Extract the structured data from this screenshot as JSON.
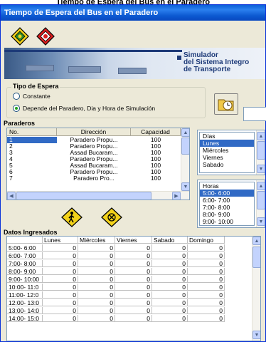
{
  "page_heading": "Tiempo de Espera del Bus en el Paradero",
  "window": {
    "title": "Tiempo de Espera del Bus en el Paradero"
  },
  "toolbar": {
    "buttons": [
      {
        "name": "yellow-diamond-icon"
      },
      {
        "name": "red-diamond-icon"
      }
    ]
  },
  "banner": {
    "line1": "Simulador",
    "line2": "del Sistema Integro",
    "line3": "de Transporte"
  },
  "tipo_espera": {
    "legend": "Tipo de Espera",
    "options": [
      {
        "label": "Constante",
        "selected": false
      },
      {
        "label": "Depende del Paradero, Dia y Hora de Simulación",
        "selected": true
      }
    ]
  },
  "clock_input_value": "",
  "paraderos": {
    "label": "Paraderos",
    "columns": [
      "No.",
      "Dirección",
      "Capacidad"
    ],
    "rows": [
      {
        "no": "1",
        "direccion": "Paradero Propu...",
        "capacidad": "100",
        "selected": true
      },
      {
        "no": "2",
        "direccion": "Paradero Propu...",
        "capacidad": "100"
      },
      {
        "no": "3",
        "direccion": "Assad Bucaram...",
        "capacidad": "100"
      },
      {
        "no": "4",
        "direccion": "Paradero Propu...",
        "capacidad": "100"
      },
      {
        "no": "5",
        "direccion": "Assad Bucaram...",
        "capacidad": "100"
      },
      {
        "no": "6",
        "direccion": "Paradero Propu...",
        "capacidad": "100"
      },
      {
        "no": "7",
        "direccion": "Paradero Pro...",
        "capacidad": "100"
      }
    ]
  },
  "dias": {
    "header": "Días",
    "items": [
      "Lunes",
      "Miércoles",
      "Viernes",
      "Sabado"
    ],
    "selected_index": 0
  },
  "horas": {
    "header": "Horas",
    "items": [
      "5:00- 6:00",
      "6:00- 7:00",
      "7:00- 8:00",
      "8:00- 9:00",
      "9:00- 10:00"
    ],
    "selected_index": 0
  },
  "action_buttons": [
    {
      "name": "walk-sign-icon"
    },
    {
      "name": "close-diamond-icon"
    }
  ],
  "datos": {
    "label": "Datos Ingresados",
    "columns": [
      "",
      "Lunes",
      "Miércoles",
      "Viernes",
      "Sabado",
      "Domingo"
    ],
    "rows": [
      {
        "label": "5:00- 6:00",
        "values": [
          "0",
          "0",
          "0",
          "0",
          "0"
        ]
      },
      {
        "label": "6:00- 7:00",
        "values": [
          "0",
          "0",
          "0",
          "0",
          "0"
        ]
      },
      {
        "label": "7:00- 8:00",
        "values": [
          "0",
          "0",
          "0",
          "0",
          "0"
        ]
      },
      {
        "label": "8:00- 9:00",
        "values": [
          "0",
          "0",
          "0",
          "0",
          "0"
        ]
      },
      {
        "label": "9:00- 10:00",
        "values": [
          "0",
          "0",
          "0",
          "0",
          "0"
        ]
      },
      {
        "label": "10:00- 11:0",
        "values": [
          "0",
          "0",
          "0",
          "0",
          "0"
        ]
      },
      {
        "label": "11:00- 12:0",
        "values": [
          "0",
          "0",
          "0",
          "0",
          "0"
        ]
      },
      {
        "label": "12:00- 13:0",
        "values": [
          "0",
          "0",
          "0",
          "0",
          "0"
        ]
      },
      {
        "label": "13:00- 14:0",
        "values": [
          "0",
          "0",
          "0",
          "0",
          "0"
        ]
      },
      {
        "label": "14:00- 15:0",
        "values": [
          "0",
          "0",
          "0",
          "0",
          "0"
        ]
      }
    ]
  },
  "colors": {
    "titlebar": "#0a5fd8",
    "selection": "#316ac5",
    "window_bg": "#ece9d8"
  }
}
